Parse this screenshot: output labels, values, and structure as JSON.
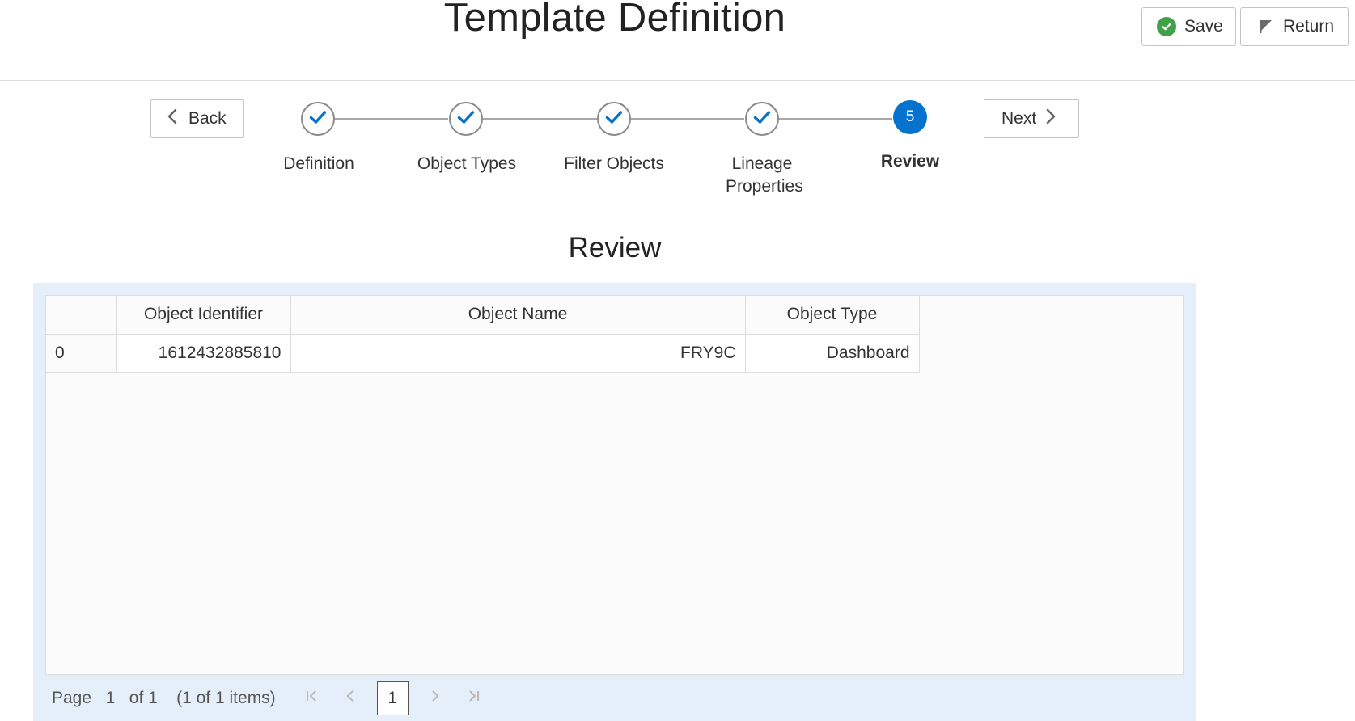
{
  "header": {
    "title": "Template Definition",
    "save_label": "Save",
    "return_label": "Return"
  },
  "train": {
    "back_label": "Back",
    "next_label": "Next",
    "steps": [
      {
        "label": "Definition",
        "status": "complete"
      },
      {
        "label": "Object Types",
        "status": "complete"
      },
      {
        "label": "Filter Objects",
        "status": "complete"
      },
      {
        "label": "Lineage Properties",
        "status": "complete"
      },
      {
        "label": "Review",
        "status": "current",
        "number": "5"
      }
    ]
  },
  "review": {
    "title": "Review",
    "columns": [
      "",
      "Object Identifier",
      "Object Name",
      "Object Type"
    ],
    "rows": [
      {
        "index": "0",
        "identifier": "1612432885810",
        "name": "FRY9C",
        "type": "Dashboard"
      }
    ]
  },
  "pagination": {
    "page_label": "Page",
    "current_page": "1",
    "of_label": "of 1",
    "items_label": "(1 of 1 items)",
    "page_button": "1"
  },
  "colors": {
    "accent": "#0572ce",
    "save_icon": "#41a14b",
    "panel_background": "#e4eff9"
  },
  "icons": {
    "save": "check-circle-icon",
    "return": "flag-icon",
    "back": "chevron-left-icon",
    "next": "chevron-right-icon",
    "step_done": "checkmark-icon"
  }
}
